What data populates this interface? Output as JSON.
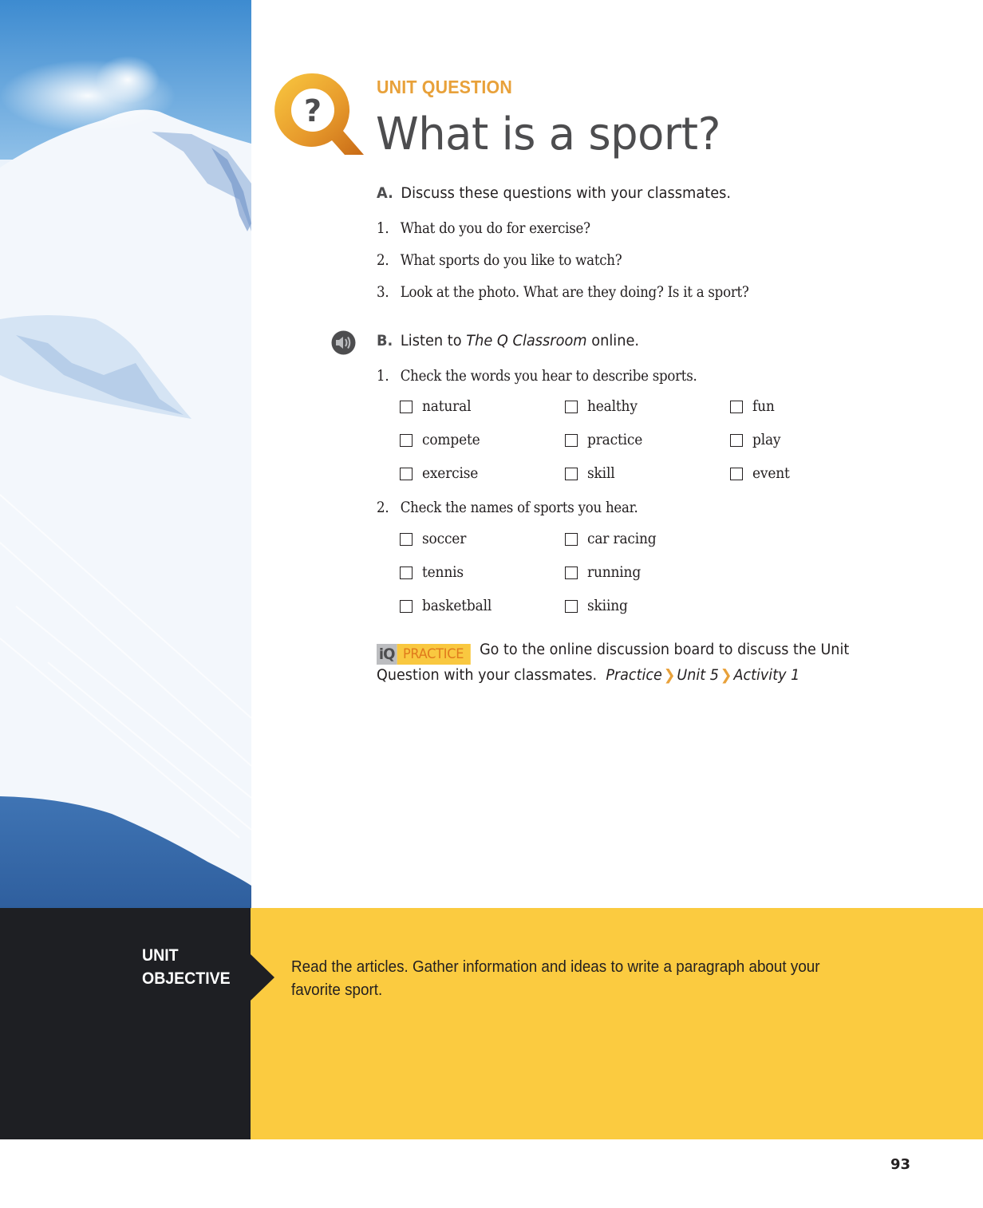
{
  "photo": {
    "description": "snowy mountain slope under blue sky",
    "icon": "photo-image"
  },
  "header": {
    "logo_icon": "q-question-mark-icon",
    "logo_glyph": "?",
    "label": "UNIT QUESTION",
    "title": "What is a sport?",
    "accent_color": "#e8a13a"
  },
  "section_a": {
    "letter": "A.",
    "instruction": "Discuss these questions with your classmates.",
    "questions": [
      {
        "num": "1.",
        "text": "What do you do for exercise?"
      },
      {
        "num": "2.",
        "text": "What sports do you like to watch?"
      },
      {
        "num": "3.",
        "text": "Look at the photo. What are they doing? Is it a sport?"
      }
    ]
  },
  "section_b": {
    "audio_icon": "speaker-audio-icon",
    "letter": "B.",
    "instruction_prefix": "Listen to ",
    "instruction_italic": "The Q Classroom",
    "instruction_suffix": " online.",
    "task1": {
      "num": "1.",
      "text": "Check the words you hear to describe sports.",
      "options": [
        {
          "label": "natural",
          "checked": false
        },
        {
          "label": "healthy",
          "checked": false
        },
        {
          "label": "fun",
          "checked": false
        },
        {
          "label": "compete",
          "checked": false
        },
        {
          "label": "practice",
          "checked": false
        },
        {
          "label": "play",
          "checked": false
        },
        {
          "label": "exercise",
          "checked": false
        },
        {
          "label": "skill",
          "checked": false
        },
        {
          "label": "event",
          "checked": false
        }
      ]
    },
    "task2": {
      "num": "2.",
      "text": "Check the names of sports you hear.",
      "options": [
        {
          "label": "soccer",
          "checked": false
        },
        {
          "label": "car racing",
          "checked": false
        },
        {
          "label": "tennis",
          "checked": false
        },
        {
          "label": "running",
          "checked": false
        },
        {
          "label": "basketball",
          "checked": false
        },
        {
          "label": "skiing",
          "checked": false
        }
      ]
    }
  },
  "iq_practice": {
    "badge_iq": "iQ",
    "badge_label": "PRACTICE",
    "text": "Go to the online discussion board to discuss the Unit Question with your classmates.",
    "path": [
      "Practice",
      "Unit 5",
      "Activity 1"
    ],
    "separator": "❯"
  },
  "objective": {
    "label_line1": "UNIT",
    "label_line2": "OBJECTIVE",
    "text": "Read the articles. Gather information and ideas to write a paragraph about your favorite sport.",
    "band_color": "#fbcb40",
    "dark_color": "#1e1f23"
  },
  "page_number": "93"
}
